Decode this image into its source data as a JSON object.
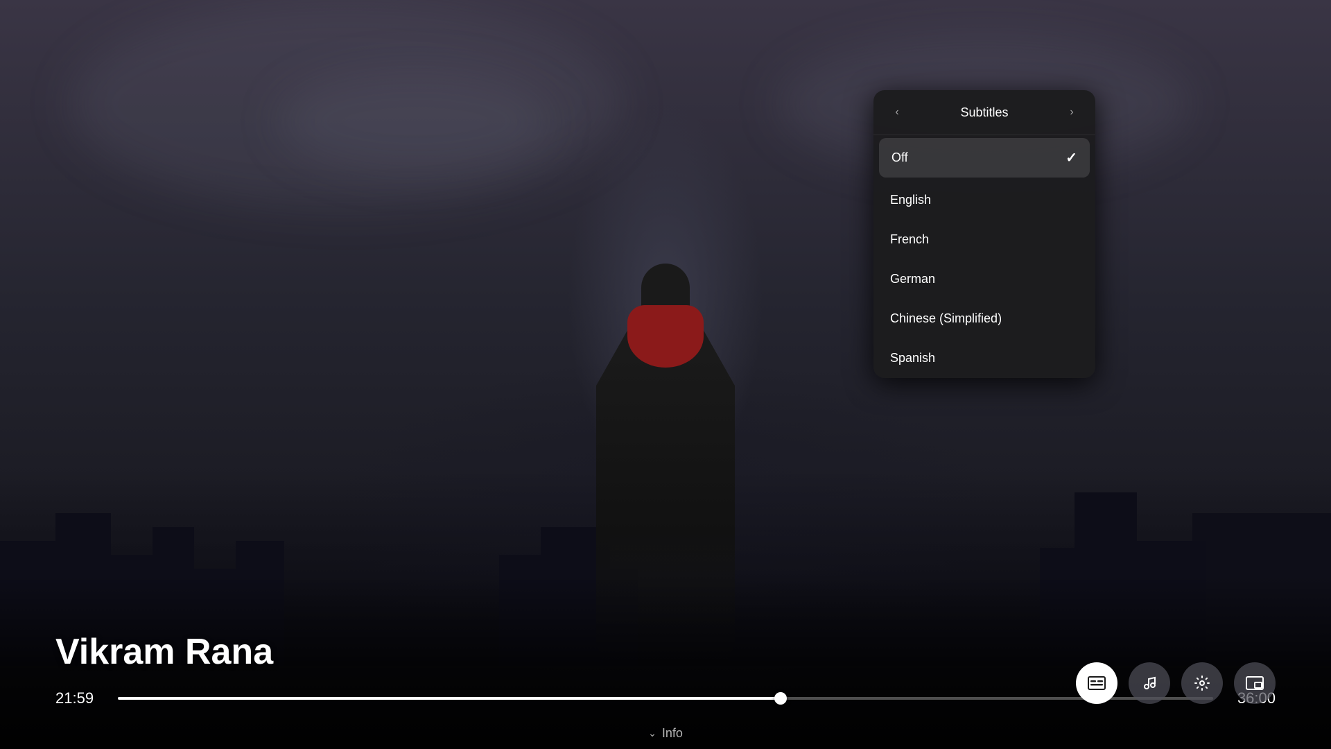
{
  "background": {
    "gradient_description": "Dark cinematic background with superhero figure"
  },
  "movie": {
    "title": "Vikram Rana"
  },
  "player": {
    "time_current": "21:59",
    "time_total": "36:00",
    "progress_percent": 60.5
  },
  "subtitles_panel": {
    "title": "Subtitles",
    "back_arrow": "‹",
    "forward_arrow": "›",
    "options": [
      {
        "id": "off",
        "label": "Off",
        "selected": true
      },
      {
        "id": "english",
        "label": "English",
        "selected": false
      },
      {
        "id": "french",
        "label": "French",
        "selected": false
      },
      {
        "id": "german",
        "label": "German",
        "selected": false
      },
      {
        "id": "chinese-simplified",
        "label": "Chinese (Simplified)",
        "selected": false
      },
      {
        "id": "spanish",
        "label": "Spanish",
        "selected": false
      }
    ]
  },
  "controls": {
    "icons": [
      {
        "id": "subtitles",
        "label": "CC",
        "active": true
      },
      {
        "id": "audio",
        "label": "♪",
        "active": false
      },
      {
        "id": "settings",
        "label": "⚙",
        "active": false
      },
      {
        "id": "picture-in-picture",
        "label": "⬜",
        "active": false
      }
    ]
  },
  "info_bar": {
    "chevron": "⌄",
    "label": "Info"
  }
}
